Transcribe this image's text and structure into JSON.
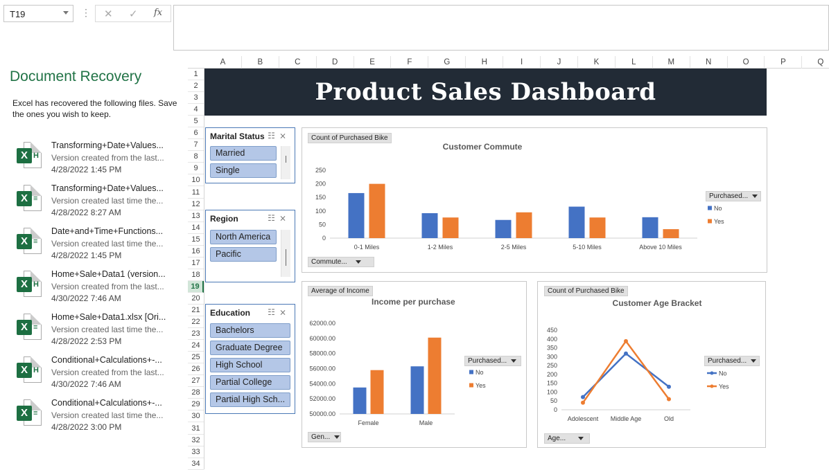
{
  "formula_bar": {
    "name_box": "T19",
    "fx": "fx",
    "cancel": "✕",
    "enter": "✓",
    "content": ""
  },
  "recovery": {
    "title": "Document Recovery",
    "description": "Excel has recovered the following files.  Save the ones you wish to keep.",
    "files": [
      {
        "name": "Transforming+Date+Values...",
        "sub": "Version created from the last...",
        "date": "4/28/2022 1:45 PM",
        "type": "autosave"
      },
      {
        "name": "Transforming+Date+Values...",
        "sub": "Version created last time the...",
        "date": "4/28/2022 8:27 AM",
        "type": "original"
      },
      {
        "name": "Date+and+Time+Functions...",
        "sub": "Version created last time the...",
        "date": "4/28/2022 1:45 PM",
        "type": "original"
      },
      {
        "name": "Home+Sale+Data1 (version...",
        "sub": "Version created from the last...",
        "date": "4/30/2022 7:46 AM",
        "type": "autosave"
      },
      {
        "name": "Home+Sale+Data1.xlsx  [Ori...",
        "sub": "Version created last time the...",
        "date": "4/28/2022 2:53 PM",
        "type": "original"
      },
      {
        "name": "Conditional+Calculations+-...",
        "sub": "Version created from the last...",
        "date": "4/30/2022 7:46 AM",
        "type": "autosave"
      },
      {
        "name": "Conditional+Calculations+-...",
        "sub": "Version created last time the...",
        "date": "4/28/2022 3:00 PM",
        "type": "original"
      }
    ]
  },
  "grid": {
    "columns": [
      "A",
      "B",
      "C",
      "D",
      "E",
      "F",
      "G",
      "H",
      "I",
      "J",
      "K",
      "L",
      "M",
      "N",
      "O",
      "P",
      "Q"
    ],
    "rows": [
      "1",
      "2",
      "3",
      "4",
      "5",
      "6",
      "7",
      "8",
      "9",
      "10",
      "11",
      "12",
      "13",
      "14",
      "15",
      "16",
      "17",
      "18",
      "19",
      "20",
      "21",
      "22",
      "23",
      "24",
      "25",
      "26",
      "27",
      "28",
      "29",
      "30",
      "31",
      "32",
      "33",
      "34"
    ],
    "selected_row": "19"
  },
  "dashboard": {
    "title": "Product Sales Dashboard"
  },
  "slicers": {
    "marital": {
      "title": "Marital Status",
      "items": [
        "Married",
        "Single"
      ]
    },
    "region": {
      "title": "Region",
      "items": [
        "North America",
        "Pacific"
      ]
    },
    "education": {
      "title": "Education",
      "items": [
        "Bachelors",
        "Graduate Degree",
        "High School",
        "Partial College",
        "Partial High Sch..."
      ]
    }
  },
  "charts": {
    "commute": {
      "field_top": "Count of Purchased Bike",
      "field_bottom": "Commute...",
      "legend_button": "Purchased...",
      "title": "Customer Commute"
    },
    "income": {
      "field_top": "Average of Income",
      "field_bottom": "Gen...",
      "legend_button": "Purchased...",
      "title": "Income per purchase"
    },
    "age": {
      "field_top": "Count of Purchased Bike",
      "field_bottom": "Age...",
      "legend_button": "Purchased...",
      "title": "Customer Age Bracket"
    }
  },
  "colors": {
    "no": "#4472c4",
    "yes": "#ed7d31",
    "excel_green": "#217346",
    "banner": "#222b36"
  },
  "chart_data": [
    {
      "type": "bar",
      "title": "Customer Commute",
      "categories": [
        "0-1 Miles",
        "1-2 Miles",
        "2-5 Miles",
        "5-10 Miles",
        "Above 10 Miles"
      ],
      "series": [
        {
          "name": "No",
          "values": [
            166,
            92,
            67,
            116,
            77
          ]
        },
        {
          "name": "Yes",
          "values": [
            200,
            76,
            95,
            76,
            33
          ]
        }
      ],
      "ylim": [
        0,
        250
      ],
      "yticks": [
        "0",
        "50",
        "100",
        "150",
        "200",
        "250"
      ],
      "legend": "right"
    },
    {
      "type": "bar",
      "title": "Income per purchase",
      "categories": [
        "Female",
        "Male"
      ],
      "series": [
        {
          "name": "No",
          "values": [
            53500,
            56300
          ]
        },
        {
          "name": "Yes",
          "values": [
            55800,
            60100
          ]
        }
      ],
      "ylim": [
        50000,
        62000
      ],
      "yticks": [
        "50000.00",
        "52000.00",
        "54000.00",
        "56000.00",
        "58000.00",
        "60000.00",
        "62000.00"
      ],
      "legend": "right"
    },
    {
      "type": "line",
      "title": "Customer Age Bracket",
      "categories": [
        "Adolescent",
        "Middle Age",
        "Old"
      ],
      "series": [
        {
          "name": "No",
          "values": [
            72,
            318,
            130
          ]
        },
        {
          "name": "Yes",
          "values": [
            40,
            388,
            60
          ]
        }
      ],
      "ylim": [
        0,
        450
      ],
      "yticks": [
        "0",
        "50",
        "100",
        "150",
        "200",
        "250",
        "300",
        "350",
        "400",
        "450"
      ],
      "legend": "right"
    }
  ]
}
